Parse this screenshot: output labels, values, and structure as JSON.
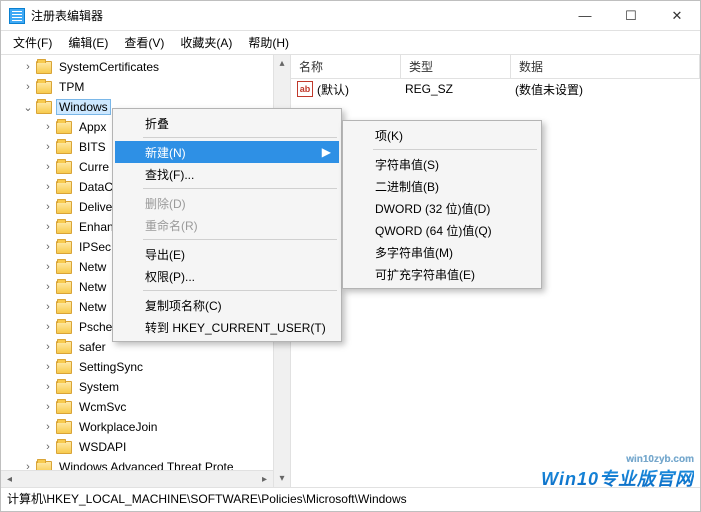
{
  "window": {
    "title": "注册表编辑器"
  },
  "menubar": [
    "文件(F)",
    "编辑(E)",
    "查看(V)",
    "收藏夹(A)",
    "帮助(H)"
  ],
  "tree": {
    "items": [
      {
        "indent": 20,
        "toggle": ">",
        "label": "SystemCertificates"
      },
      {
        "indent": 20,
        "toggle": ">",
        "label": "TPM"
      },
      {
        "indent": 20,
        "toggle": "v",
        "label": "Windows",
        "selected": true
      },
      {
        "indent": 40,
        "toggle": ">",
        "label": "Appx"
      },
      {
        "indent": 40,
        "toggle": ">",
        "label": "BITS"
      },
      {
        "indent": 40,
        "toggle": ">",
        "label": "Curre"
      },
      {
        "indent": 40,
        "toggle": ">",
        "label": "DataC"
      },
      {
        "indent": 40,
        "toggle": ">",
        "label": "Delive"
      },
      {
        "indent": 40,
        "toggle": ">",
        "label": "Enhan"
      },
      {
        "indent": 40,
        "toggle": ">",
        "label": "IPSec"
      },
      {
        "indent": 40,
        "toggle": ">",
        "label": "Netw"
      },
      {
        "indent": 40,
        "toggle": ">",
        "label": "Netw"
      },
      {
        "indent": 40,
        "toggle": ">",
        "label": "Netw"
      },
      {
        "indent": 40,
        "toggle": ">",
        "label": "Psche"
      },
      {
        "indent": 40,
        "toggle": ">",
        "label": "safer"
      },
      {
        "indent": 40,
        "toggle": ">",
        "label": "SettingSync"
      },
      {
        "indent": 40,
        "toggle": ">",
        "label": "System"
      },
      {
        "indent": 40,
        "toggle": ">",
        "label": "WcmSvc"
      },
      {
        "indent": 40,
        "toggle": ">",
        "label": "WorkplaceJoin"
      },
      {
        "indent": 40,
        "toggle": ">",
        "label": "WSDAPI"
      },
      {
        "indent": 20,
        "toggle": ">",
        "label": "Windows Advanced Threat Prote"
      }
    ]
  },
  "list": {
    "headers": {
      "name": "名称",
      "type": "类型",
      "data": "数据"
    },
    "rows": [
      {
        "name": "(默认)",
        "type": "REG_SZ",
        "data": "(数值未设置)"
      }
    ]
  },
  "statusbar": "计算机\\HKEY_LOCAL_MACHINE\\SOFTWARE\\Policies\\Microsoft\\Windows",
  "ctx1": {
    "collapse": "折叠",
    "new": "新建(N)",
    "find": "查找(F)...",
    "delete": "删除(D)",
    "rename": "重命名(R)",
    "export": "导出(E)",
    "perm": "权限(P)...",
    "copykey": "复制项名称(C)",
    "goto": "转到 HKEY_CURRENT_USER(T)"
  },
  "ctx2": {
    "key": "项(K)",
    "string": "字符串值(S)",
    "binary": "二进制值(B)",
    "dword": "DWORD (32 位)值(D)",
    "qword": "QWORD (64 位)值(Q)",
    "multi": "多字符串值(M)",
    "expand": "可扩充字符串值(E)"
  },
  "watermark": {
    "sub": "win10zyb.com",
    "main": "Win10专业版官网"
  }
}
